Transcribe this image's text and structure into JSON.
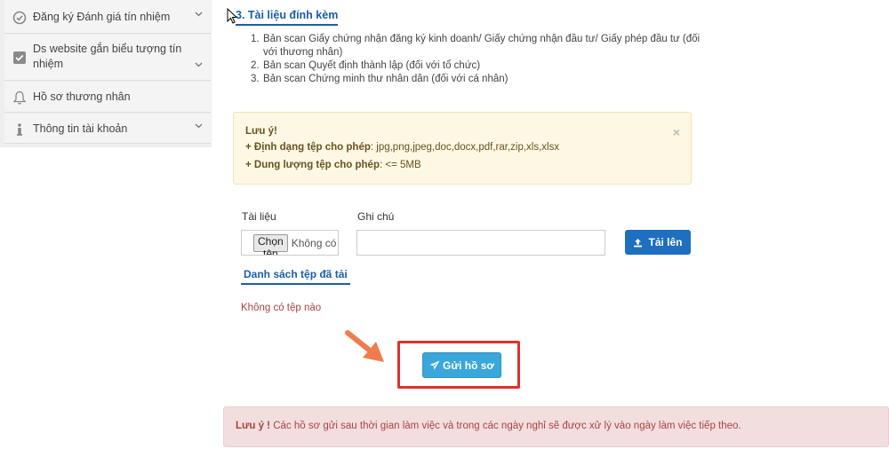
{
  "sidebar": {
    "items": [
      {
        "label": "Đăng ký Đánh giá tín nhiệm",
        "icon": "check-circle-icon",
        "has_chevron": true
      },
      {
        "label": "Ds website gắn biểu tượng tín nhiệm",
        "icon": "check-square-icon",
        "has_chevron": true
      },
      {
        "label": "Hồ sơ thương nhân",
        "icon": "bell-icon",
        "has_chevron": false
      },
      {
        "label": "Thông tin tài khoản",
        "icon": "info-icon",
        "has_chevron": true
      }
    ]
  },
  "attachments": {
    "title": "3. Tài liệu đính kèm",
    "items": [
      {
        "num": "1.",
        "text": "Bản scan Giấy chứng nhận đăng ký kinh doanh/ Giấy chứng nhận đầu tư/ Giấy phép đầu tư (đối với thương nhân)"
      },
      {
        "num": "2.",
        "text": "Bản scan Quyết định thành lập (đối với tổ chức)"
      },
      {
        "num": "3.",
        "text": "Bản scan Chứng minh thư nhân dân (đối với cá nhân)"
      }
    ]
  },
  "warning": {
    "title": "Lưu ý!",
    "formats_label": "+ Định dạng tệp cho phép",
    "formats_value": ": jpg,png,jpeg,doc,docx,pdf,rar,zip,xls,xlsx",
    "size_label": "+ Dung lượng tệp cho phép",
    "size_value": ": <= 5MB",
    "close": "×"
  },
  "upload": {
    "doc_label": "Tài liệu",
    "note_label": "Ghi chú",
    "choose_file": "Chọn tệp",
    "file_name": "Không có tệp nào được chọn",
    "note_value": "",
    "upload_button": "Tải lên"
  },
  "uploaded": {
    "title": "Danh sách tệp đã tải",
    "empty": "Không có tệp nào"
  },
  "submit": {
    "label": "Gửi hồ sơ"
  },
  "alert": {
    "label": "Lưu ý !",
    "text": " Các hồ sơ gửi sau thời gian làm việc và trong các ngày nghỉ sẽ được xử lý vào ngày làm việc tiếp theo."
  },
  "colors": {
    "primary": "#1e6fbf",
    "submit": "#3aa7dc",
    "highlight": "#e0302b",
    "arrow": "#f07b4d",
    "warning_bg": "#fcf8e3",
    "alert_bg": "#f2dede"
  }
}
